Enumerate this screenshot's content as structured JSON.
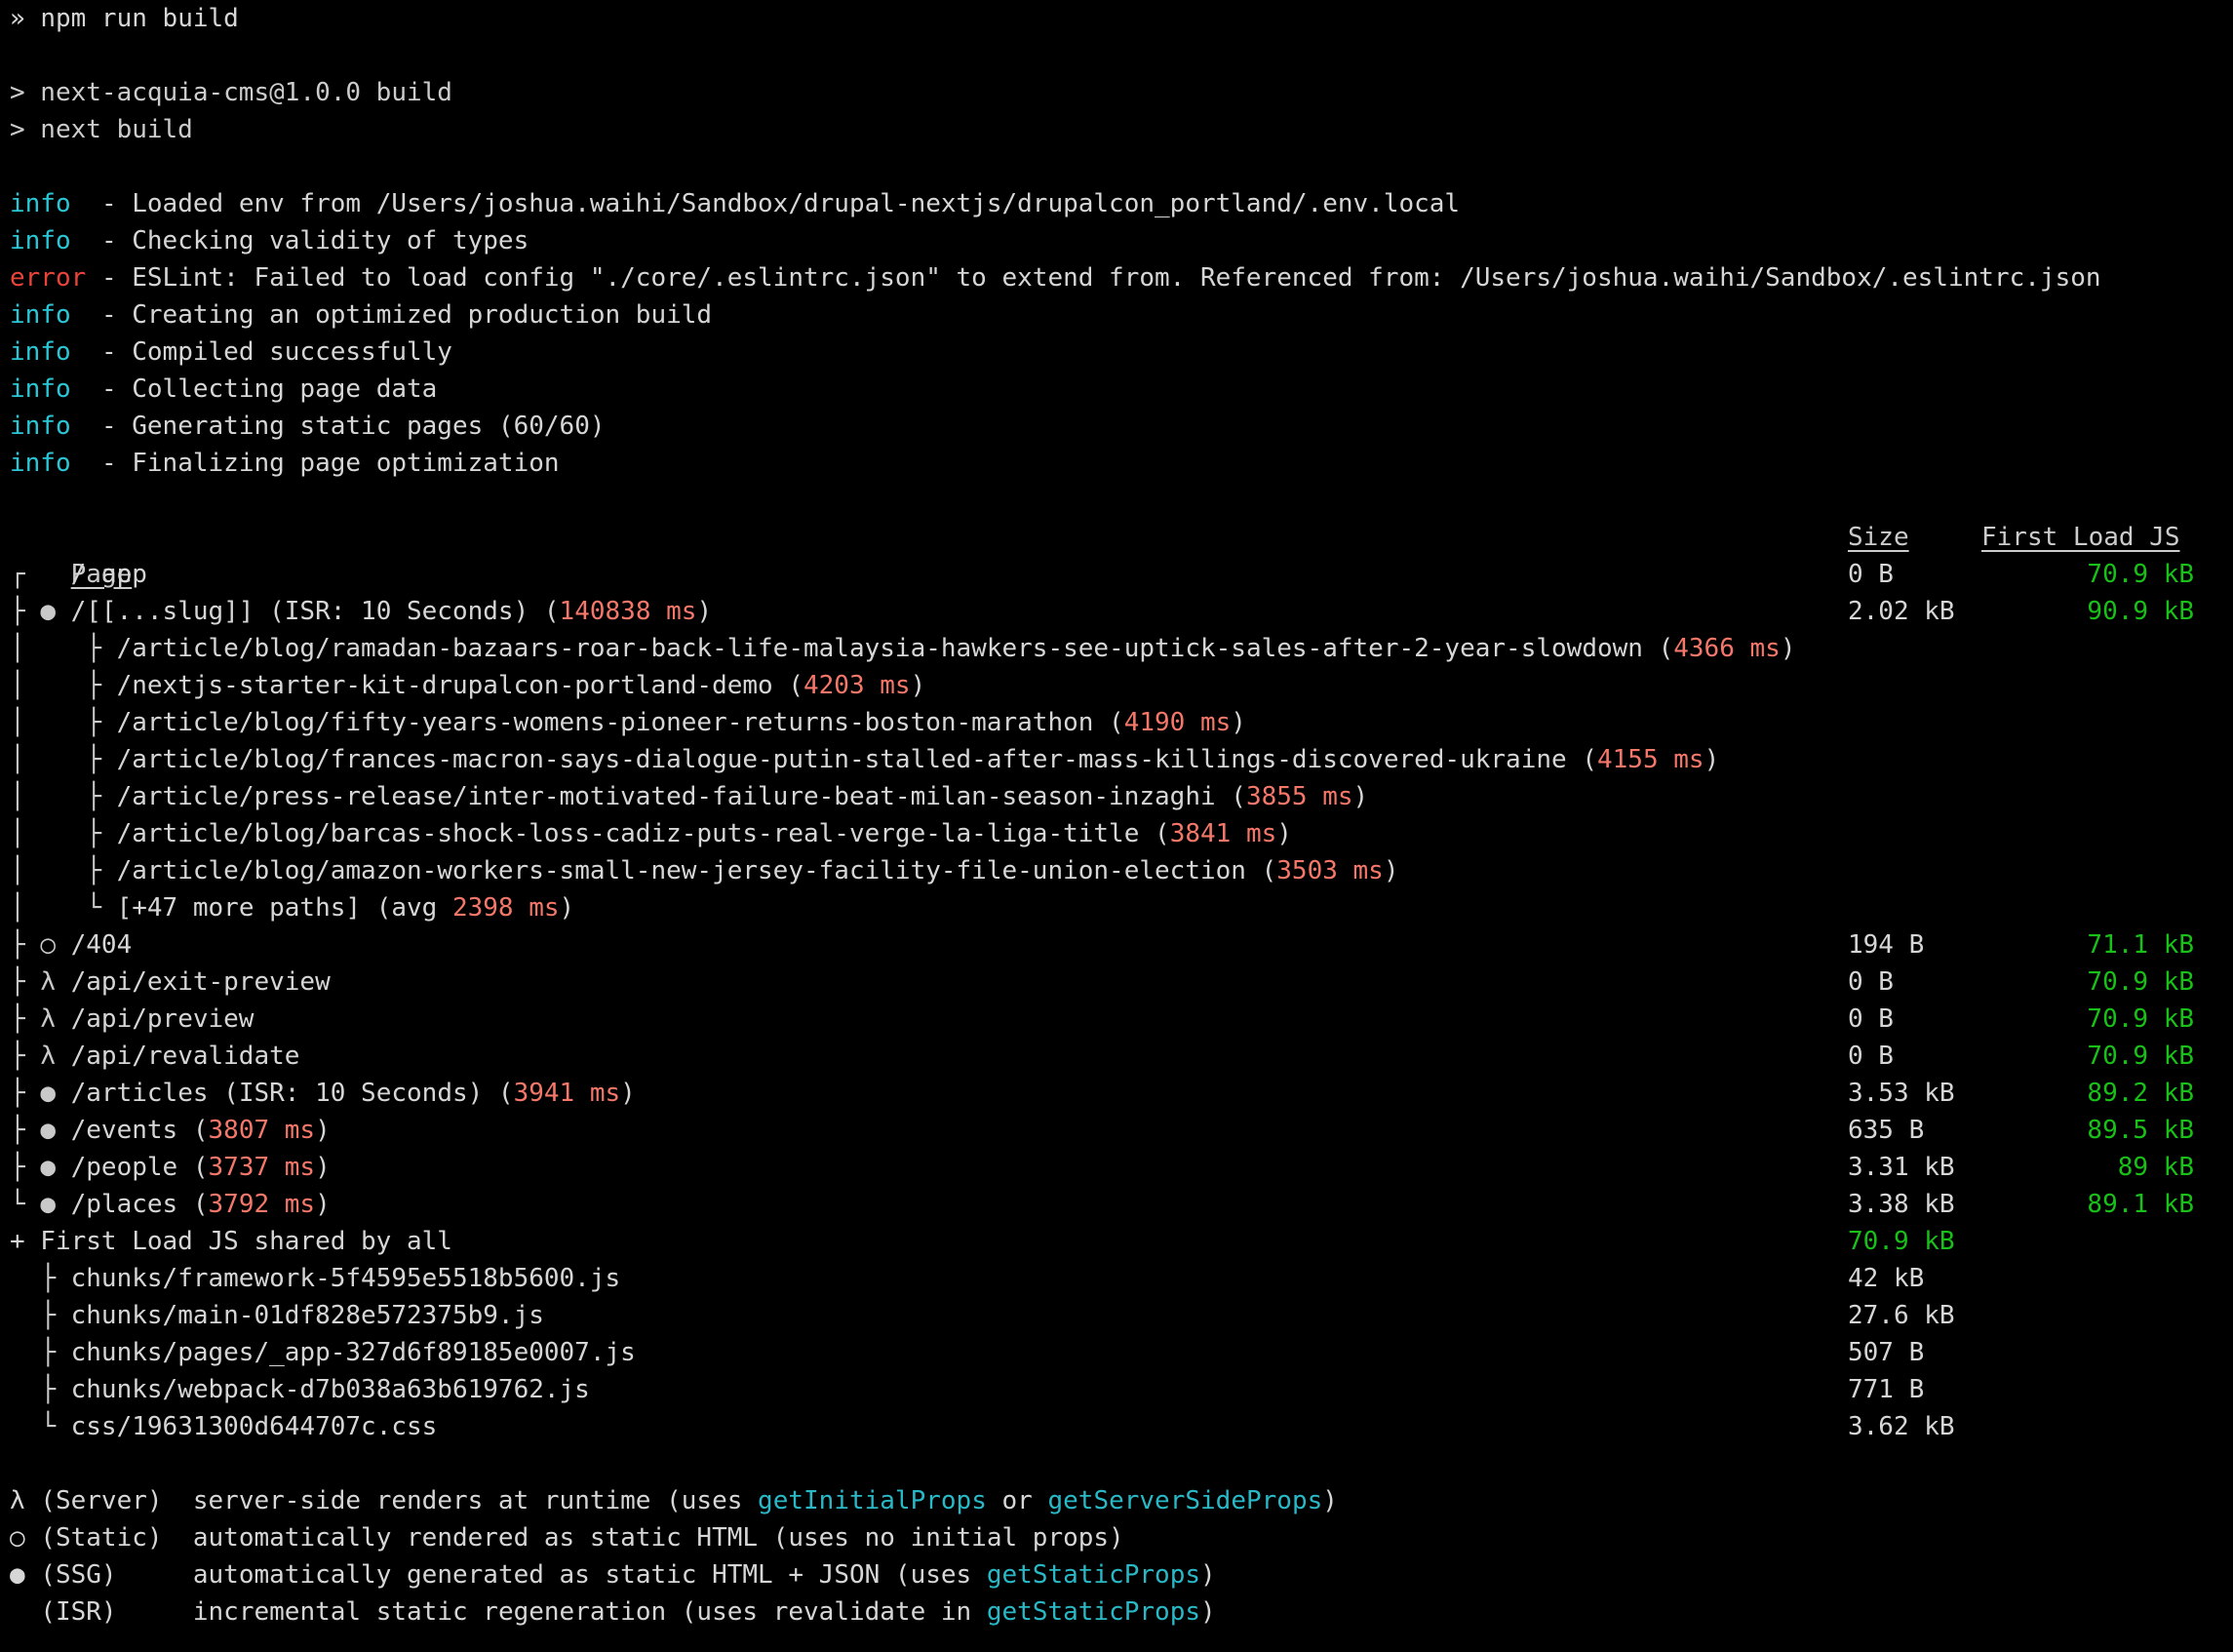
{
  "terminal": {
    "prompt_symbol": "»",
    "command": "npm run build",
    "npm_package_line": "> next-acquia-cms@1.0.0 build",
    "npm_script_line": "> next build"
  },
  "log_lines": [
    {
      "level": "info",
      "text": "- Loaded env from /Users/joshua.waihi/Sandbox/drupal-nextjs/drupalcon_portland/.env.local"
    },
    {
      "level": "info",
      "text": "- Checking validity of types"
    },
    {
      "level": "error",
      "text": "- ESLint: Failed to load config \"./core/.eslintrc.json\" to extend from. Referenced from: /Users/joshua.waihi/Sandbox/.eslintrc.json"
    },
    {
      "level": "info",
      "text": "- Creating an optimized production build"
    },
    {
      "level": "info",
      "text": "- Compiled successfully"
    },
    {
      "level": "info",
      "text": "- Collecting page data"
    },
    {
      "level": "info",
      "text": "- Generating static pages (60/60)"
    },
    {
      "level": "info",
      "text": "- Finalizing page optimization"
    }
  ],
  "table": {
    "headers": {
      "page": "Page",
      "size": "Size",
      "first_load_js": "First Load JS"
    },
    "rows": [
      {
        "tree": "┌",
        "marker": "",
        "page": "/_app",
        "meta": "",
        "timing": "",
        "size": "0 B",
        "flj": "70.9 kB"
      },
      {
        "tree": "├",
        "marker": "●",
        "page": "/[[...slug]]",
        "meta": "(ISR: 10 Seconds)",
        "timing": "(140838 ms)",
        "size": "2.02 kB",
        "flj": "90.9 kB"
      }
    ],
    "sub_paths": [
      {
        "path": "/article/blog/ramadan-bazaars-roar-back-life-malaysia-hawkers-see-uptick-sales-after-2-year-slowdown",
        "timing": "4366 ms"
      },
      {
        "path": "/nextjs-starter-kit-drupalcon-portland-demo",
        "timing": "4203 ms"
      },
      {
        "path": "/article/blog/fifty-years-womens-pioneer-returns-boston-marathon",
        "timing": "4190 ms"
      },
      {
        "path": "/article/blog/frances-macron-says-dialogue-putin-stalled-after-mass-killings-discovered-ukraine",
        "timing": "4155 ms"
      },
      {
        "path": "/article/press-release/inter-motivated-failure-beat-milan-season-inzaghi",
        "timing": "3855 ms"
      },
      {
        "path": "/article/blog/barcas-shock-loss-cadiz-puts-real-verge-la-liga-title",
        "timing": "3841 ms"
      },
      {
        "path": "/article/blog/amazon-workers-small-new-jersey-facility-file-union-election",
        "timing": "3503 ms"
      },
      {
        "path": "[+47 more paths]",
        "timing": "2398 ms",
        "avg_prefix": "avg "
      }
    ],
    "routes": [
      {
        "tree": "├",
        "marker": "○",
        "page": "/404",
        "meta": "",
        "timing": "",
        "size": "194 B",
        "flj": "71.1 kB"
      },
      {
        "tree": "├",
        "marker": "λ",
        "page": "/api/exit-preview",
        "meta": "",
        "timing": "",
        "size": "0 B",
        "flj": "70.9 kB"
      },
      {
        "tree": "├",
        "marker": "λ",
        "page": "/api/preview",
        "meta": "",
        "timing": "",
        "size": "0 B",
        "flj": "70.9 kB"
      },
      {
        "tree": "├",
        "marker": "λ",
        "page": "/api/revalidate",
        "meta": "",
        "timing": "",
        "size": "0 B",
        "flj": "70.9 kB"
      },
      {
        "tree": "├",
        "marker": "●",
        "page": "/articles",
        "meta": "(ISR: 10 Seconds)",
        "timing": "(3941 ms)",
        "size": "3.53 kB",
        "flj": "89.2 kB"
      },
      {
        "tree": "├",
        "marker": "●",
        "page": "/events",
        "meta": "",
        "timing": "(3807 ms)",
        "size": "635 B",
        "flj": "89.5 kB"
      },
      {
        "tree": "├",
        "marker": "●",
        "page": "/people",
        "meta": "",
        "timing": "(3737 ms)",
        "size": "3.31 kB",
        "flj": "89 kB"
      },
      {
        "tree": "└",
        "marker": "●",
        "page": "/places",
        "meta": "",
        "timing": "(3792 ms)",
        "size": "3.38 kB",
        "flj": "89.1 kB"
      }
    ],
    "shared": {
      "label": "+ First Load JS shared by all",
      "total": "70.9 kB",
      "chunks": [
        {
          "tree": "├",
          "name": "chunks/framework-5f4595e5518b5600.js",
          "size": "42 kB"
        },
        {
          "tree": "├",
          "name": "chunks/main-01df828e572375b9.js",
          "size": "27.6 kB"
        },
        {
          "tree": "├",
          "name": "chunks/pages/_app-327d6f89185e0007.js",
          "size": "507 B"
        },
        {
          "tree": "├",
          "name": "chunks/webpack-d7b038a63b619762.js",
          "size": "771 B"
        },
        {
          "tree": "└",
          "name": "css/19631300d644707c.css",
          "size": "3.62 kB"
        }
      ]
    }
  },
  "legend": [
    {
      "marker": "λ",
      "label": "(Server)",
      "pad": "  ",
      "pre": "server-side renders at runtime (uses ",
      "fn1": "getInitialProps",
      "mid": " or ",
      "fn2": "getServerSideProps",
      "post": ")"
    },
    {
      "marker": "○",
      "label": "(Static)",
      "pad": "  ",
      "pre": "automatically rendered as static HTML (uses no initial props)",
      "fn1": "",
      "mid": "",
      "fn2": "",
      "post": ""
    },
    {
      "marker": "●",
      "label": "(SSG)",
      "pad": "     ",
      "pre": "automatically generated as static HTML + JSON (uses ",
      "fn1": "getStaticProps",
      "mid": "",
      "fn2": "",
      "post": ")"
    },
    {
      "marker": " ",
      "label": "(ISR)",
      "pad": "     ",
      "pre": "incremental static regeneration (uses revalidate in ",
      "fn1": "getStaticProps",
      "mid": "",
      "fn2": "",
      "post": ")"
    }
  ],
  "colors": {
    "background": "#000000",
    "foreground": "#cccccc",
    "info": "#2bc6d6",
    "error": "#e8443a",
    "timing": "#f4776a",
    "size_green": "#18c018",
    "link_cyan": "#29b8c6"
  }
}
